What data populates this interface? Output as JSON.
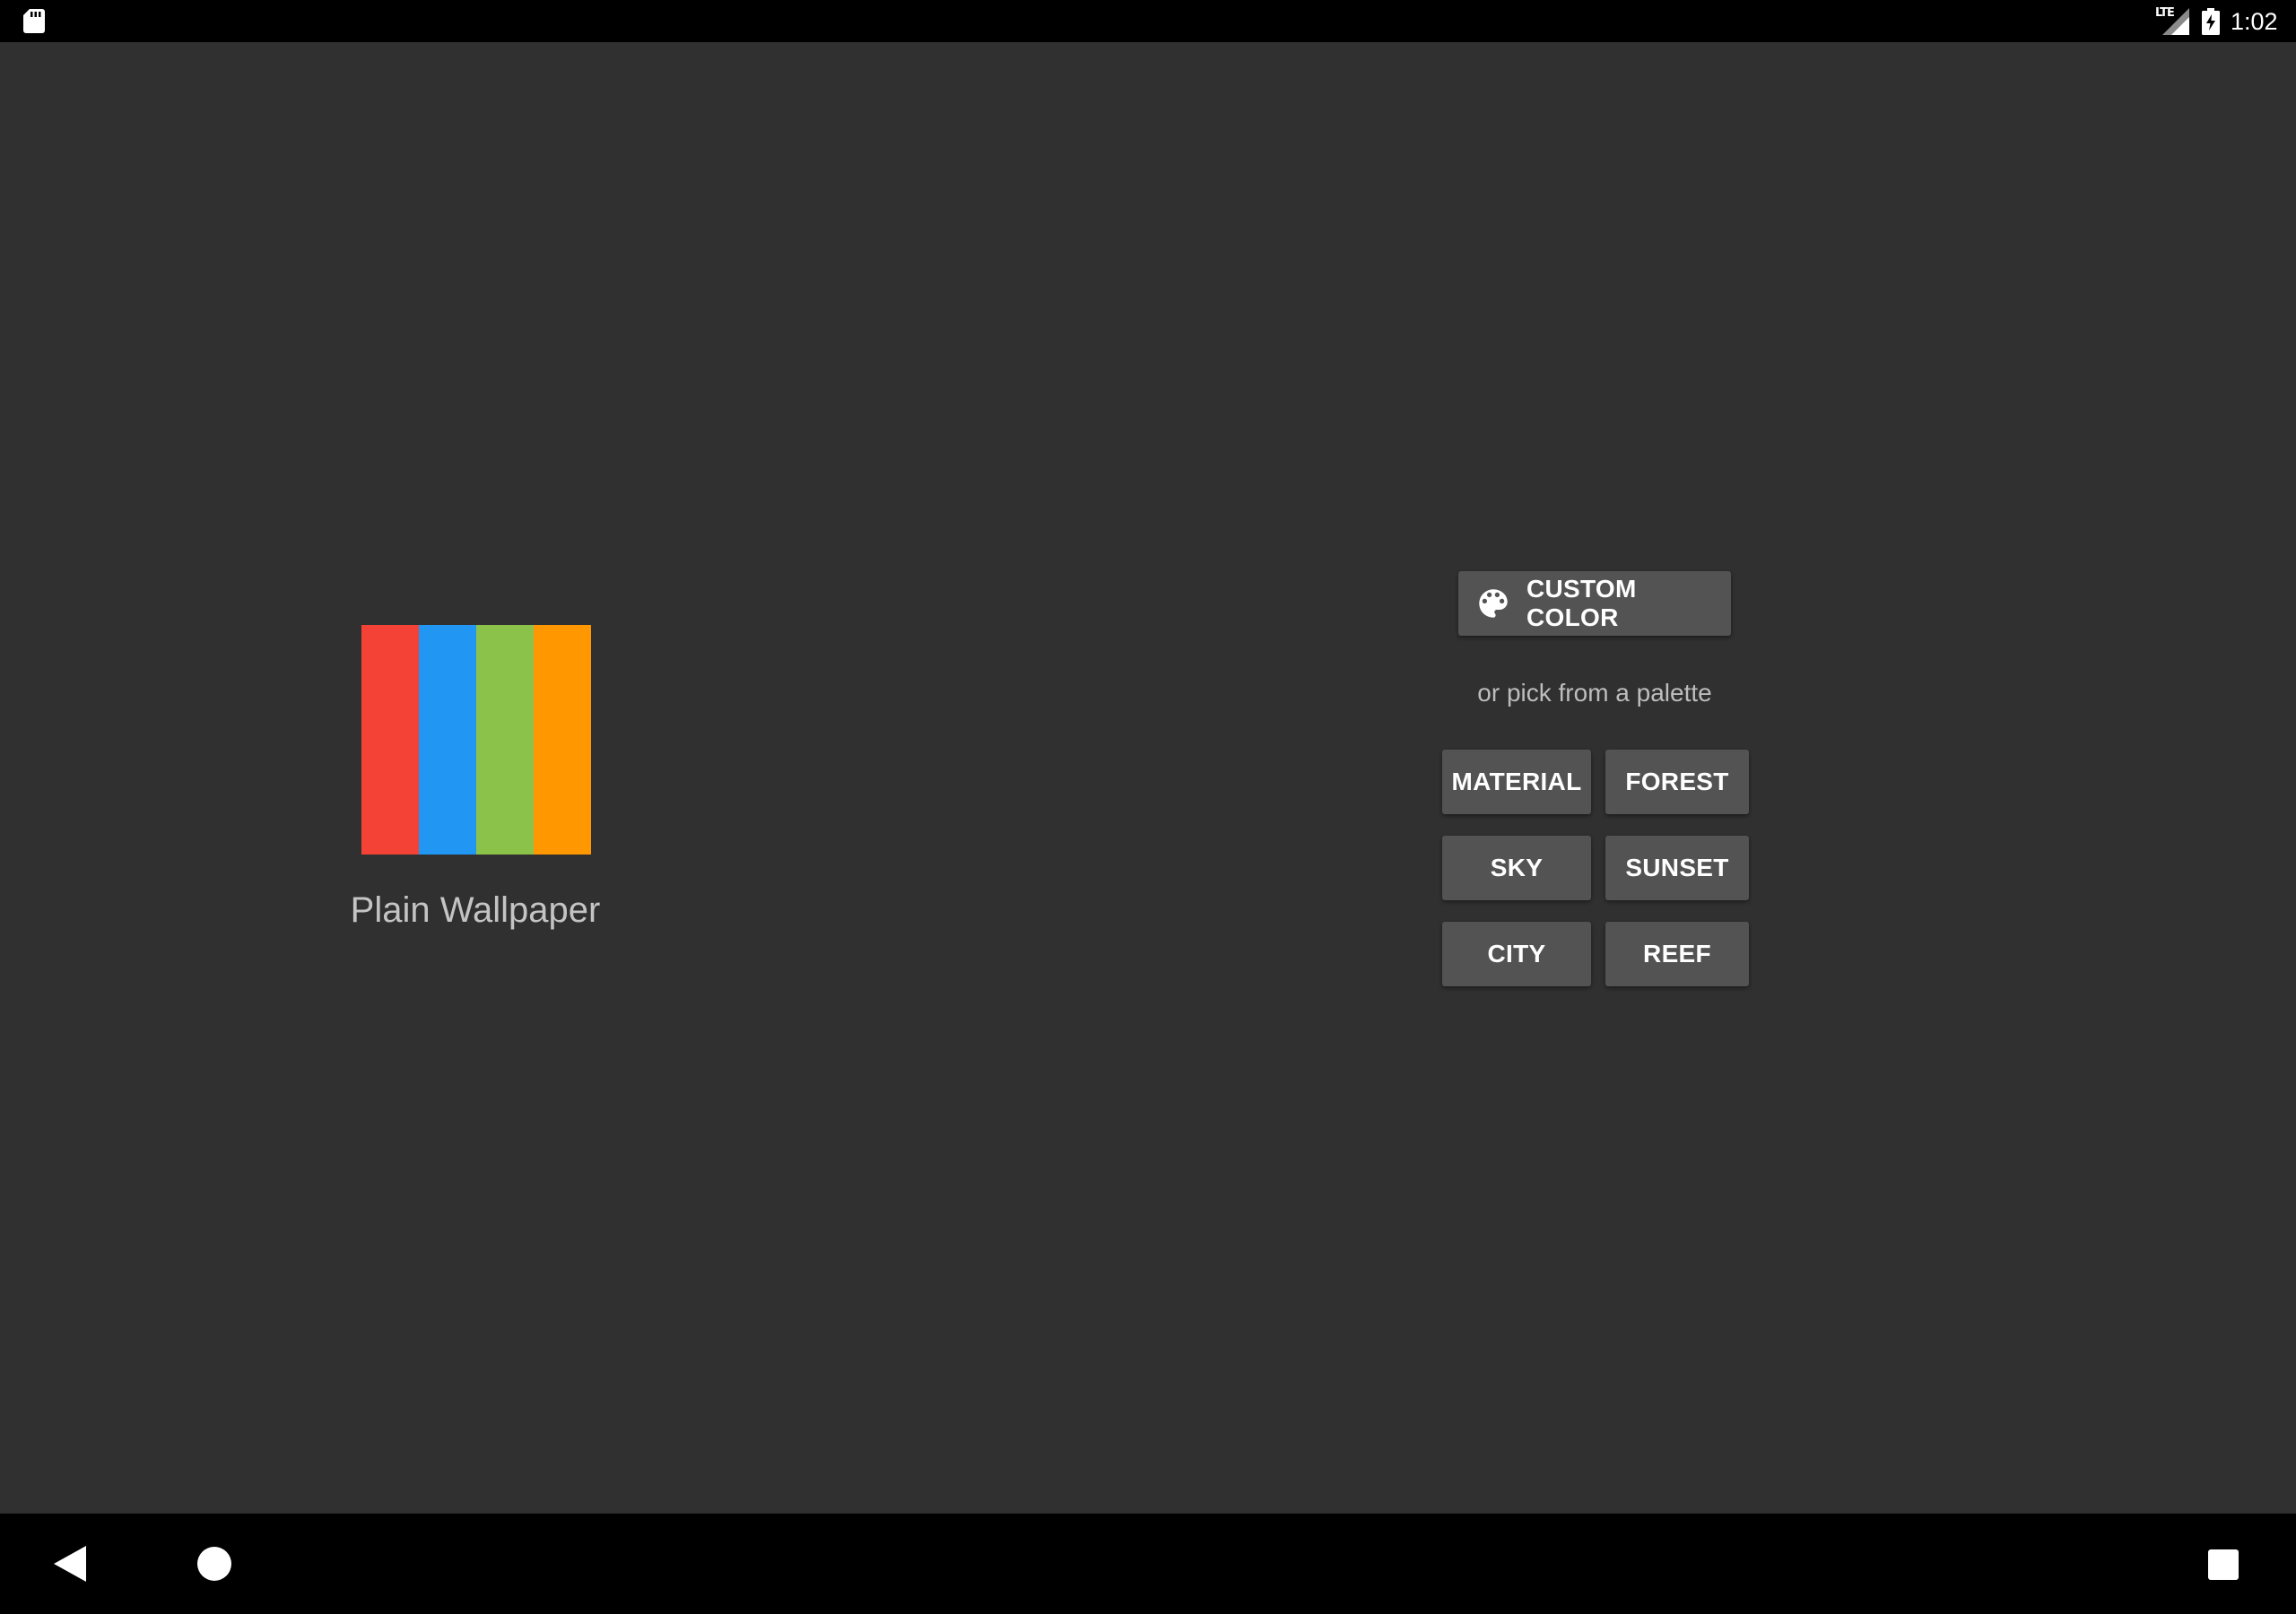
{
  "status_bar": {
    "time": "1:02",
    "network": "LTE",
    "icons": [
      "sd-card-icon",
      "lte-signal-icon",
      "battery-charging-icon"
    ]
  },
  "app": {
    "name": "Plain Wallpaper",
    "logo_colors": [
      "#f44336",
      "#2196f3",
      "#8bc34a",
      "#ff9800"
    ]
  },
  "custom_color_button": {
    "label": "CUSTOM COLOR",
    "icon": "palette-icon"
  },
  "palette_prompt": "or pick from a palette",
  "palettes": [
    {
      "label": "MATERIAL"
    },
    {
      "label": "FOREST"
    },
    {
      "label": "SKY"
    },
    {
      "label": "SUNSET"
    },
    {
      "label": "CITY"
    },
    {
      "label": "REEF"
    }
  ],
  "nav_bar": {
    "icons": [
      "back-icon",
      "home-icon",
      "recents-icon"
    ]
  },
  "colors": {
    "background": "#303030",
    "button": "#535353",
    "system_bars": "#000000"
  }
}
